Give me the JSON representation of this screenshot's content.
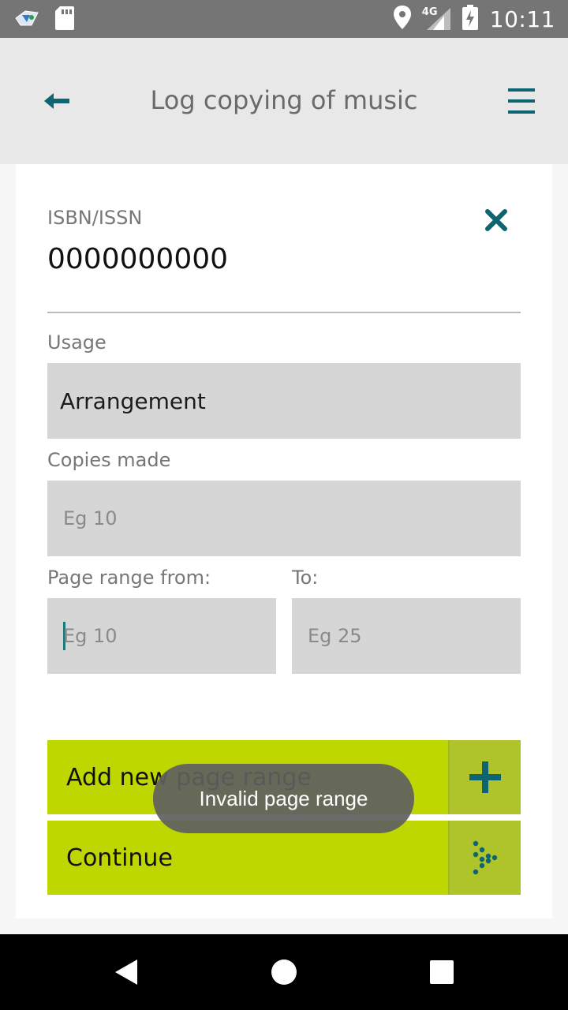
{
  "status_bar": {
    "time": "10:11",
    "network": "4G",
    "icons": [
      "app-notification-icon",
      "sd-card-icon",
      "location-icon",
      "signal-icon",
      "battery-charging-icon"
    ]
  },
  "app_bar": {
    "title": "Log copying of music",
    "back_icon": "back-arrow-icon",
    "menu_icon": "hamburger-menu-icon"
  },
  "form": {
    "isbn_label": "ISBN/ISSN",
    "isbn_value": "0000000000",
    "usage_label": "Usage",
    "usage_value": "Arrangement",
    "copies_label": "Copies made",
    "copies_placeholder": "Eg 10",
    "page_from_label": "Page range from:",
    "page_from_placeholder": "Eg 10",
    "page_to_label": "To:",
    "page_to_placeholder": "Eg 25"
  },
  "buttons": {
    "add_range": "Add new page range",
    "continue": "Continue"
  },
  "toast": "Invalid page range",
  "colors": {
    "accent": "#bfd700",
    "teal": "#0f6472",
    "field_bg": "#d6d6d6"
  }
}
